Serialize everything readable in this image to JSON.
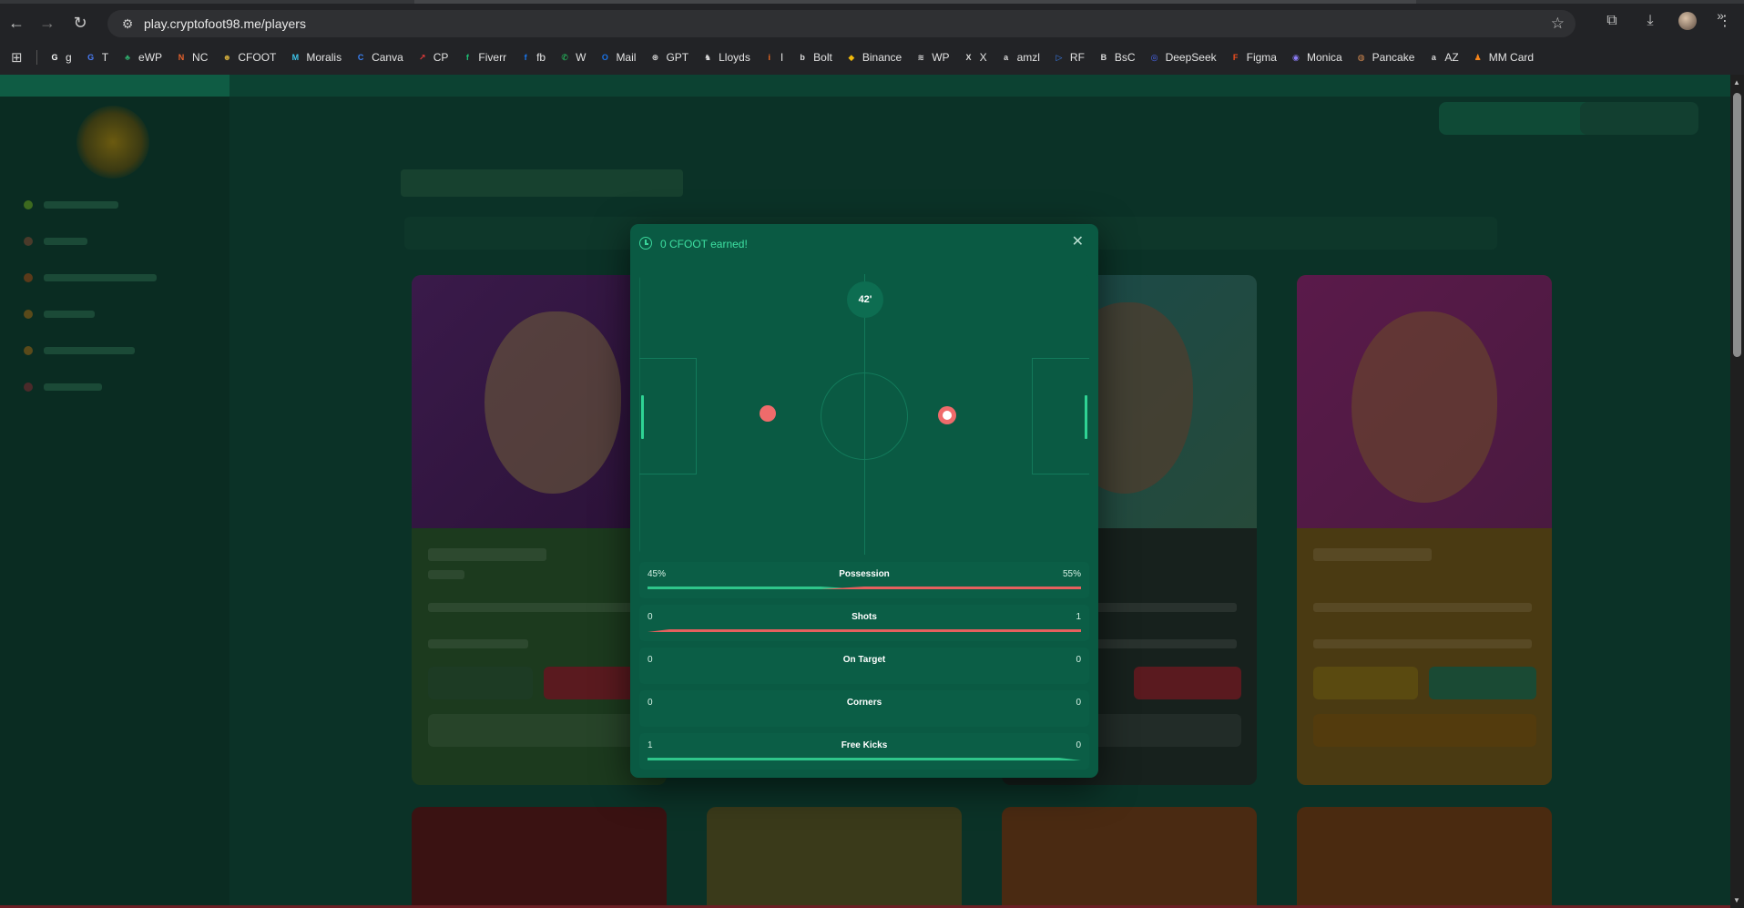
{
  "browser": {
    "url": "play.cryptofoot98.me/players",
    "bookmarks": [
      {
        "label": "g",
        "color": "#ffffff",
        "glyph": "G"
      },
      {
        "label": "T",
        "color": "#4a7cf5",
        "glyph": "G"
      },
      {
        "label": "eWP",
        "color": "#2fa66a",
        "glyph": "♣"
      },
      {
        "label": "NC",
        "color": "#e8622c",
        "glyph": "N"
      },
      {
        "label": "CFOOT",
        "color": "#c9a53a",
        "glyph": "☻"
      },
      {
        "label": "Moralis",
        "color": "#3dc3e8",
        "glyph": "M"
      },
      {
        "label": "Canva",
        "color": "#3b82f6",
        "glyph": "C"
      },
      {
        "label": "CP",
        "color": "#e33a3a",
        "glyph": "↗"
      },
      {
        "label": "Fiverr",
        "color": "#1dbf73",
        "glyph": "f"
      },
      {
        "label": "fb",
        "color": "#1877f2",
        "glyph": "f"
      },
      {
        "label": "W",
        "color": "#25d366",
        "glyph": "✆"
      },
      {
        "label": "Mail",
        "color": "#1a73e8",
        "glyph": "O"
      },
      {
        "label": "GPT",
        "color": "#dddddd",
        "glyph": "⊛"
      },
      {
        "label": "Lloyds",
        "color": "#dddddd",
        "glyph": "♞"
      },
      {
        "label": "I",
        "color": "#f26a21",
        "glyph": "i"
      },
      {
        "label": "Bolt",
        "color": "#dddddd",
        "glyph": "b"
      },
      {
        "label": "Binance",
        "color": "#f0b90b",
        "glyph": "◆"
      },
      {
        "label": "WP",
        "color": "#dddddd",
        "glyph": "≋"
      },
      {
        "label": "X",
        "color": "#dddddd",
        "glyph": "X"
      },
      {
        "label": "amzl",
        "color": "#dddddd",
        "glyph": "a"
      },
      {
        "label": "RF",
        "color": "#3b82f6",
        "glyph": "▷"
      },
      {
        "label": "BsC",
        "color": "#dddddd",
        "glyph": "B"
      },
      {
        "label": "DeepSeek",
        "color": "#4d6bfe",
        "glyph": "◎"
      },
      {
        "label": "Figma",
        "color": "#f24e1e",
        "glyph": "F"
      },
      {
        "label": "Monica",
        "color": "#8b7cf6",
        "glyph": "◉"
      },
      {
        "label": "Pancake",
        "color": "#d1884f",
        "glyph": "◍"
      },
      {
        "label": "AZ",
        "color": "#dddddd",
        "glyph": "a"
      },
      {
        "label": "MM Card",
        "color": "#f6851b",
        "glyph": "♟"
      }
    ]
  },
  "modal": {
    "title": "0 CFOOT earned!",
    "minute": "42'",
    "stats": [
      {
        "name": "Possession",
        "left": "45%",
        "right": "55%",
        "left_frac": 0.45,
        "show_bar": true
      },
      {
        "name": "Shots",
        "left": "0",
        "right": "1",
        "left_frac": 0.0,
        "show_bar": true
      },
      {
        "name": "On Target",
        "left": "0",
        "right": "0",
        "left_frac": 0.5,
        "show_bar": false
      },
      {
        "name": "Corners",
        "left": "0",
        "right": "0",
        "left_frac": 0.5,
        "show_bar": false
      },
      {
        "name": "Free Kicks",
        "left": "1",
        "right": "0",
        "left_frac": 1.0,
        "show_bar": true
      }
    ]
  },
  "colors": {
    "home": "#2fc58a",
    "away": "#e5605e",
    "accent": "#3ee0a2"
  }
}
